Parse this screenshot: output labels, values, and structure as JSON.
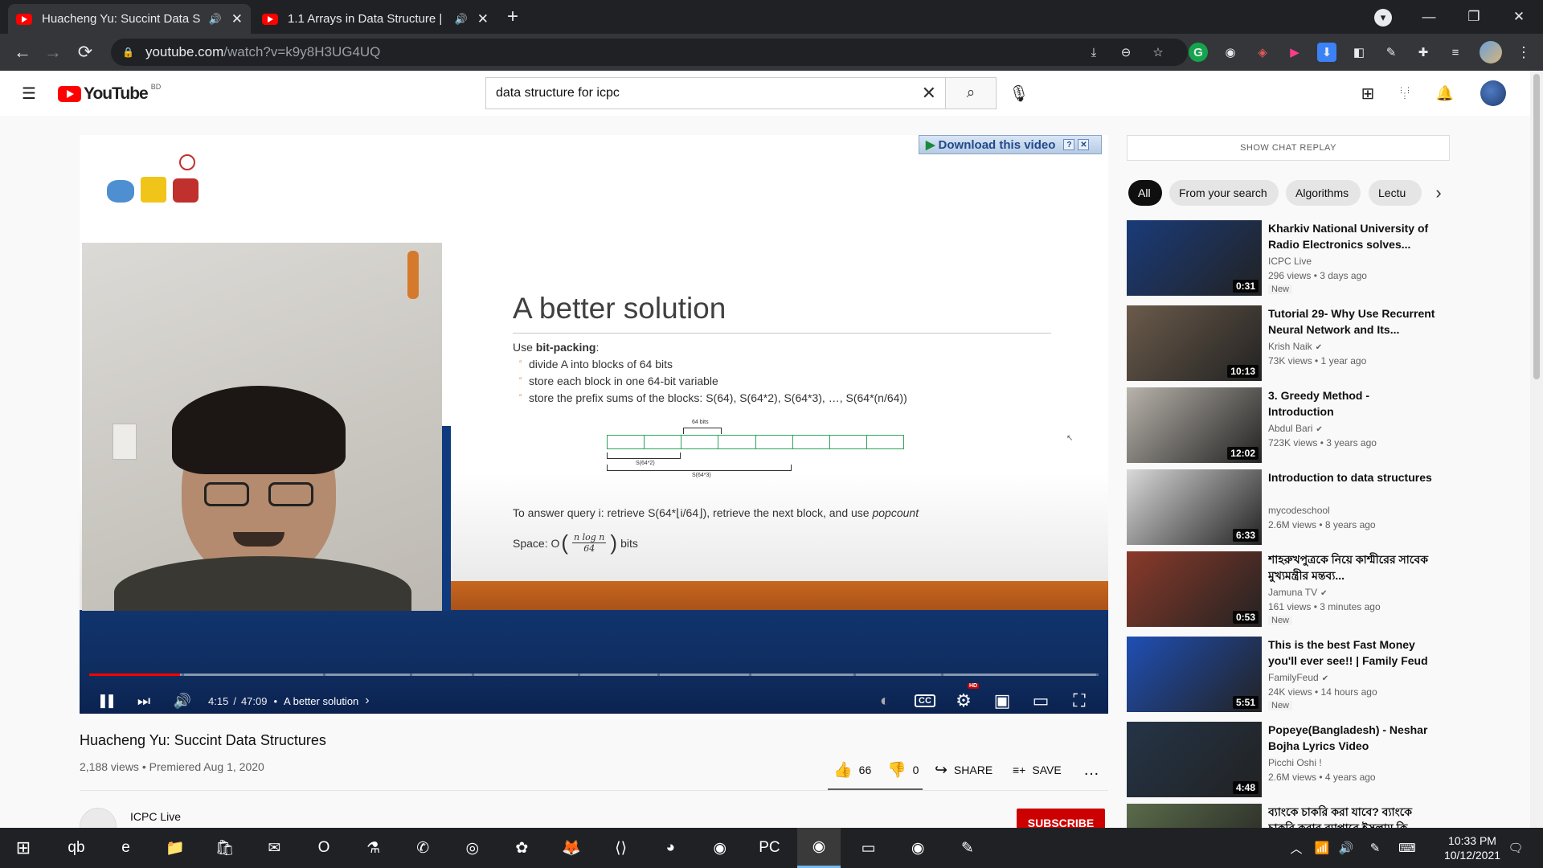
{
  "browser": {
    "tabs": [
      {
        "title": "Huacheng Yu: Succint Data S",
        "audio": "🔊",
        "close": "✕"
      },
      {
        "title": "1.1 Arrays in Data Structure |",
        "audio": "🔊",
        "close": "✕"
      }
    ],
    "new_tab": "+",
    "tab_menu": "▾",
    "window": {
      "minimize": "—",
      "maximize": "❐",
      "close": "✕"
    },
    "url_domain": "youtube.com",
    "url_path": "/watch?v=k9y8H3UG4UQ",
    "nav": {
      "back": "←",
      "forward": "→",
      "reload": "⟳"
    },
    "extensions": [
      "⤓",
      "⊖",
      "☆",
      "G",
      "◉",
      "◈",
      "▶",
      "⬇",
      "◧",
      "✎",
      "✚",
      "≡"
    ],
    "more": "⋮"
  },
  "youtube": {
    "logo_word": "YouTube",
    "country_code": "BD",
    "menu": "☰",
    "search_value": "data structure for icpc",
    "search_clear": "✕",
    "search_icon": "⌕",
    "mic_icon": "🎙",
    "create_icon": "⊞",
    "apps_icon": "⋮⋮⋮",
    "bell_icon": "🔔"
  },
  "player": {
    "download_label": "Download this video",
    "download_help": "?",
    "download_close": "✕",
    "slide": {
      "title": "A better solution",
      "use_prefix": "Use ",
      "use_bold": "bit-packing",
      "use_suffix": ":",
      "bullets": [
        "divide A into blocks of 64 bits",
        "store each block in one 64-bit variable",
        "store the prefix sums of the blocks: S(64), S(64*2), S(64*3), …, S(64*(n/64))"
      ],
      "diagram_top": "64 bits",
      "diagram_s1": "S(64*2)",
      "diagram_s2": "S(64*3)",
      "answer_prefix": "To answer query i: retrieve S(64*⌊i/64⌋), retrieve the next block, and use ",
      "answer_italic": "popcount",
      "space_prefix": "Space: O",
      "space_num": "n log n",
      "space_den": "64",
      "space_suffix": "bits"
    },
    "progress": 0.09,
    "time_current": "4:15",
    "time_sep": "/",
    "time_total": "47:09",
    "chapter_dot": "•",
    "chapter": "A better solution",
    "chapter_arrow": "›",
    "hd_badge": "HD",
    "icons": {
      "pause": "❚❚",
      "next": "⏭",
      "volume": "🔊",
      "autoplay": "◐",
      "cc": "CC",
      "settings": "⚙",
      "miniplayer": "▣",
      "theater": "▭",
      "fullscreen": "⛶"
    }
  },
  "video": {
    "title": "Huacheng Yu: Succint Data Structures",
    "stats": "2,188 views • Premiered Aug 1, 2020",
    "likes": "66",
    "dislikes": "0",
    "like_icon": "👍",
    "dislike_icon": "👎",
    "share": "SHARE",
    "share_icon": "↪",
    "save": "SAVE",
    "save_icon": "≡+",
    "more": "…",
    "channel": "ICPC Live",
    "subscribe": "SUBSCRIBE"
  },
  "sidebar": {
    "chat_replay": "SHOW CHAT REPLAY",
    "chips": [
      "All",
      "From your search",
      "Algorithms",
      "Lectu"
    ],
    "chips_next": "›",
    "videos": [
      {
        "title": "Kharkiv National University of Radio Electronics solves...",
        "channel": "ICPC Live",
        "verified": "",
        "meta": "296 views • 3 days ago",
        "badge": "New",
        "duration": "0:31",
        "color": "#1a3b7a"
      },
      {
        "title": "Tutorial 29- Why Use Recurrent Neural Network and Its...",
        "channel": "Krish Naik",
        "verified": "✔",
        "meta": "73K views • 1 year ago",
        "badge": "",
        "duration": "10:13",
        "color": "#6b5b4b"
      },
      {
        "title": "3. Greedy Method - Introduction",
        "channel": "Abdul Bari",
        "verified": "✔",
        "meta": "723K views • 3 years ago",
        "badge": "",
        "duration": "12:02",
        "color": "#b8b3ab"
      },
      {
        "title": "Introduction to data structures",
        "channel": "mycodeschool",
        "verified": "",
        "meta": "2.6M views • 8 years ago",
        "badge": "",
        "duration": "6:33",
        "color": "#d9d9d9"
      },
      {
        "title": "শাহরুখপুত্রকে নিয়ে কাশ্মীরের সাবেক মুখ্যমন্ত্রীর মন্তব্য...",
        "channel": "Jamuna TV",
        "verified": "✔",
        "meta": "161 views • 3 minutes ago",
        "badge": "New",
        "duration": "0:53",
        "color": "#8a3a2a"
      },
      {
        "title": "This is the best Fast Money you'll ever see!! | Family Feud",
        "channel": "FamilyFeud",
        "verified": "✔",
        "meta": "24K views • 14 hours ago",
        "badge": "New",
        "duration": "5:51",
        "color": "#1f4fb5"
      },
      {
        "title": "Popeye(Bangladesh) - Neshar Bojha Lyrics Video",
        "channel": "Picchi Oshi !",
        "verified": "",
        "meta": "2.6M views • 4 years ago",
        "badge": "",
        "duration": "4:48",
        "color": "#243447"
      },
      {
        "title": "ব্যাংকে চাকরি করা যাবে? ব্যাংকে চাকরি করার ব্যাপারে ইসলাম কি",
        "channel": "",
        "verified": "",
        "meta": "",
        "badge": "",
        "duration": "",
        "color": "#5a6b4a"
      }
    ]
  },
  "taskbar": {
    "start": "⊞",
    "apps": [
      "qb",
      "e",
      "📁",
      "🛍",
      "✉",
      "O",
      "⚗",
      "✆",
      "◎",
      "✿",
      "🦊",
      "⟨⟩",
      "◕",
      "◉",
      "PC",
      "◉",
      "▭",
      "◉",
      "✎"
    ],
    "tray": [
      "︿",
      "📶",
      "🔊",
      "✎",
      "⌨"
    ],
    "time": "10:33 PM",
    "date": "10/12/2021",
    "notifications": "🗨"
  }
}
